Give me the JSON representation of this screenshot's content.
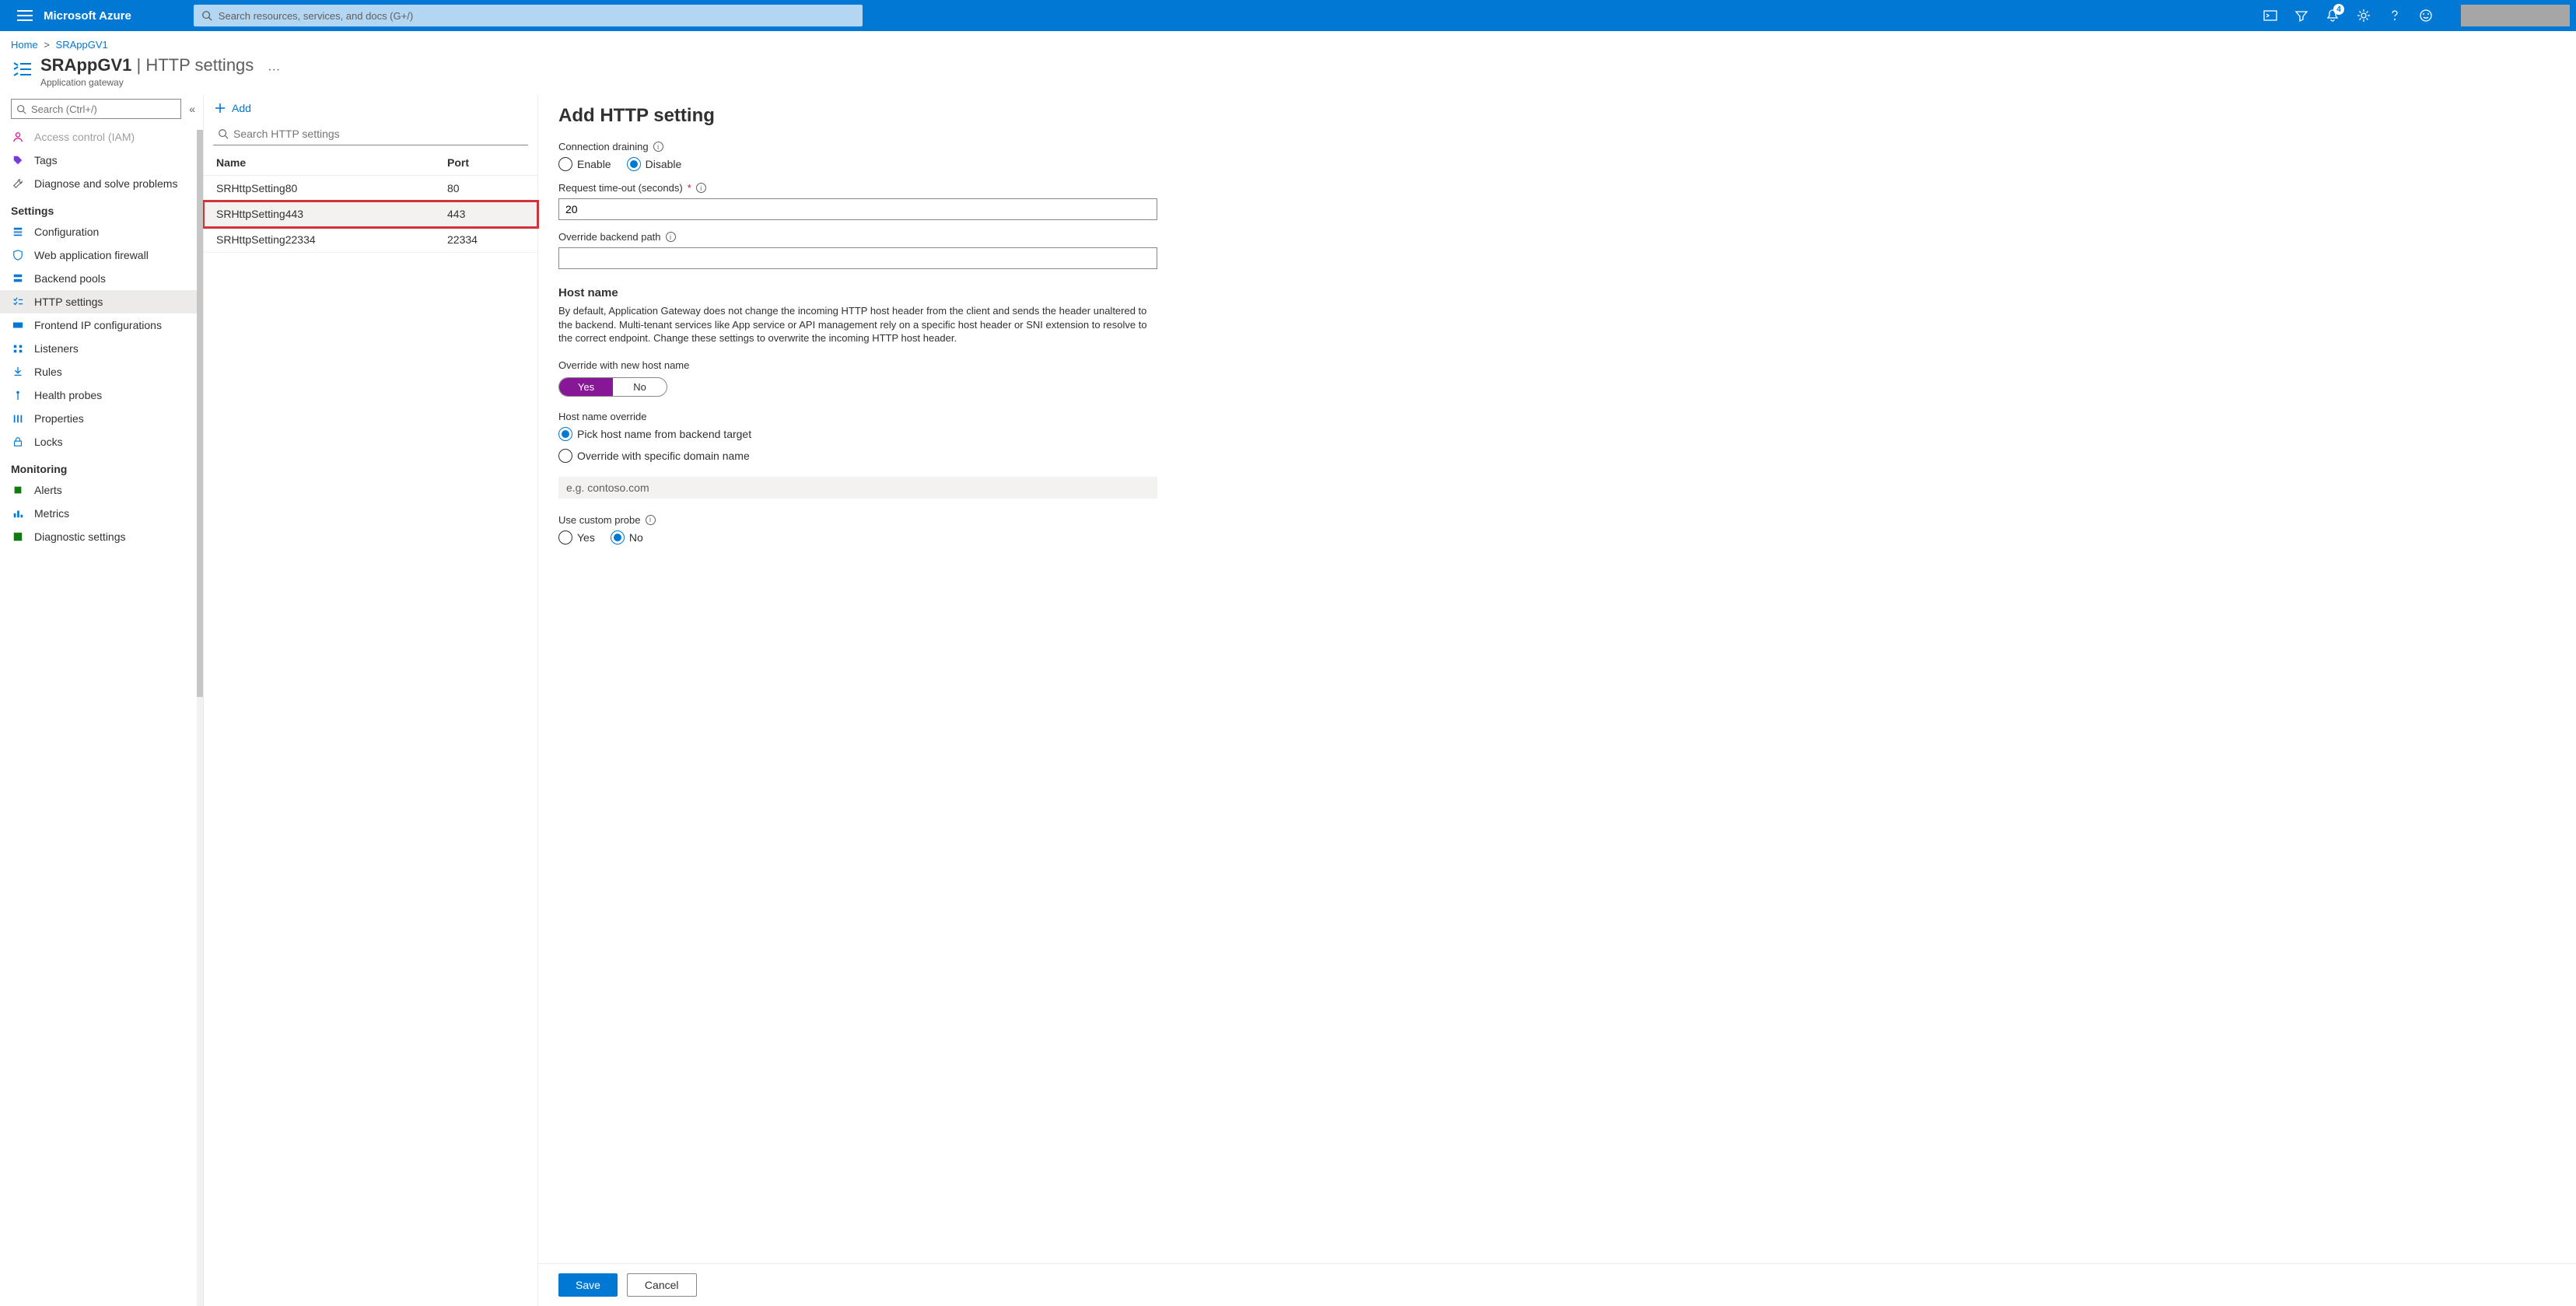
{
  "topbar": {
    "brand": "Microsoft Azure",
    "search_placeholder": "Search resources, services, and docs (G+/)",
    "notification_count": "4"
  },
  "breadcrumb": {
    "home": "Home",
    "resource": "SRAppGV1"
  },
  "blade": {
    "title_left": "SRAppGV1",
    "title_right": "HTTP settings",
    "subtitle": "Application gateway",
    "search_placeholder": "Search (Ctrl+/)"
  },
  "nav": {
    "items_top": [
      {
        "label": "Access control (IAM)"
      },
      {
        "label": "Tags"
      },
      {
        "label": "Diagnose and solve problems"
      }
    ],
    "group_settings": "Settings",
    "settings": [
      {
        "label": "Configuration"
      },
      {
        "label": "Web application firewall"
      },
      {
        "label": "Backend pools"
      },
      {
        "label": "HTTP settings",
        "selected": true
      },
      {
        "label": "Frontend IP configurations"
      },
      {
        "label": "Listeners"
      },
      {
        "label": "Rules"
      },
      {
        "label": "Health probes"
      },
      {
        "label": "Properties"
      },
      {
        "label": "Locks"
      }
    ],
    "group_monitoring": "Monitoring",
    "monitoring": [
      {
        "label": "Alerts"
      },
      {
        "label": "Metrics"
      },
      {
        "label": "Diagnostic settings"
      }
    ]
  },
  "center": {
    "add_label": "Add",
    "search_placeholder": "Search HTTP settings",
    "columns": {
      "name": "Name",
      "port": "Port"
    },
    "rows": [
      {
        "name": "SRHttpSetting80",
        "port": "80"
      },
      {
        "name": "SRHttpSetting443",
        "port": "443",
        "highlight": true
      },
      {
        "name": "SRHttpSetting22334",
        "port": "22334"
      }
    ]
  },
  "panel": {
    "title": "Add HTTP setting",
    "conn_drain_label": "Connection draining",
    "enable": "Enable",
    "disable": "Disable",
    "timeout_label": "Request time-out (seconds)",
    "timeout_value": "20",
    "override_path_label": "Override backend path",
    "hostname_h": "Host name",
    "hostname_help": "By default, Application Gateway does not change the incoming HTTP host header from the client and sends the header unaltered to the backend. Multi-tenant services like App service or API management rely on a specific host header or SNI extension to resolve to the correct endpoint. Change these settings to overwrite the incoming HTTP host header.",
    "override_host_label": "Override with new host name",
    "yes": "Yes",
    "no": "No",
    "host_override_label": "Host name override",
    "host_opt_pick": "Pick host name from backend target",
    "host_opt_spec": "Override with specific domain name",
    "domain_placeholder": "e.g. contoso.com",
    "custom_probe_label": "Use custom probe",
    "save": "Save",
    "cancel": "Cancel"
  }
}
